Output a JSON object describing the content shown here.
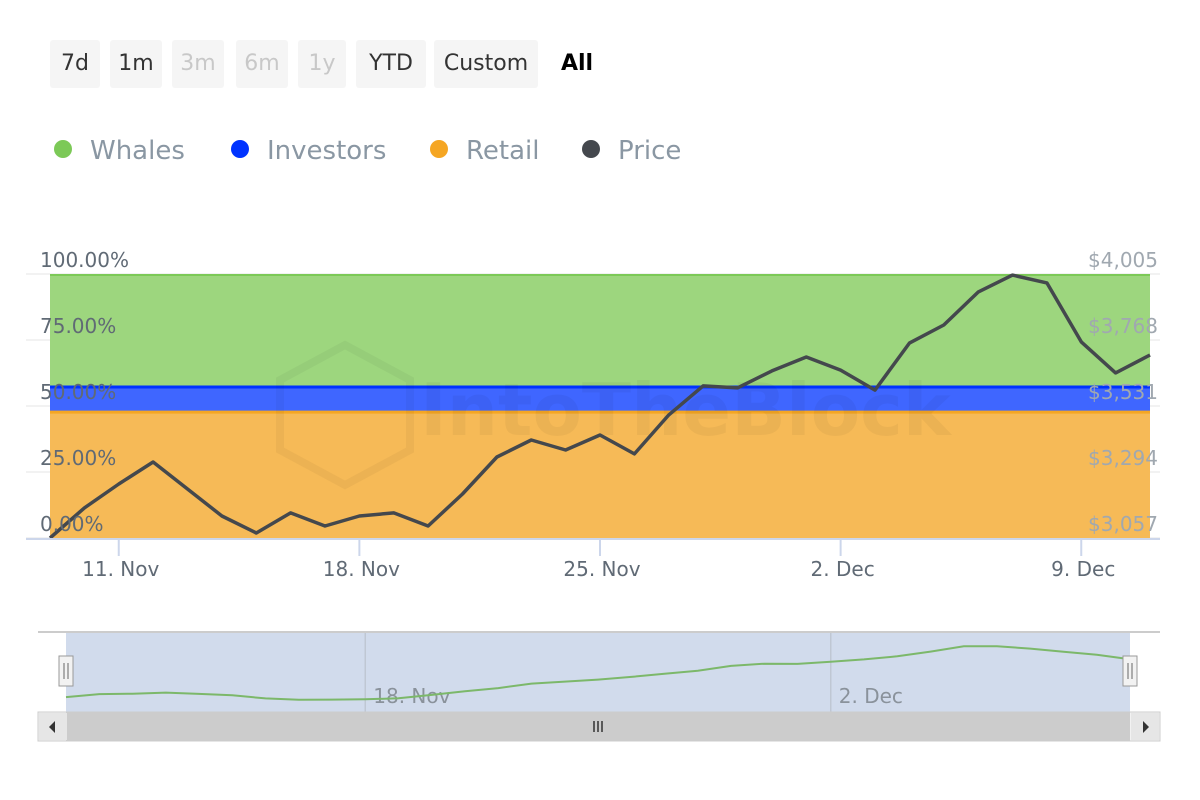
{
  "range_buttons": [
    {
      "label": "7d",
      "state": "enabled"
    },
    {
      "label": "1m",
      "state": "enabled"
    },
    {
      "label": "3m",
      "state": "disabled"
    },
    {
      "label": "6m",
      "state": "disabled"
    },
    {
      "label": "1y",
      "state": "disabled"
    },
    {
      "label": "YTD",
      "state": "enabled"
    },
    {
      "label": "Custom",
      "state": "enabled"
    },
    {
      "label": "All",
      "state": "active"
    }
  ],
  "watermark": "IntoTheBlock",
  "chart_data": {
    "type": "area",
    "stacking": "percent",
    "legend": [
      "Whales",
      "Investors",
      "Retail",
      "Price"
    ],
    "legend_placement": "top-left",
    "colors": {
      "Whales": "#7cc957",
      "Investors": "#0033ff",
      "Retail": "#f5a623",
      "Price": "#44484d"
    },
    "x_start": "2024-11-09",
    "x_end": "2024-12-11",
    "x_ticks": [
      "11. Nov",
      "18. Nov",
      "25. Nov",
      "2. Dec",
      "9. Dec"
    ],
    "y_left_ticks": [
      "0.00%",
      "25.00%",
      "50.00%",
      "75.00%",
      "100.00%"
    ],
    "y_right_ticks": [
      "$3,057",
      "$3,294",
      "$3,531",
      "$3,768",
      "$4,005"
    ],
    "y_right_range": [
      3057,
      4005
    ],
    "series": [
      {
        "name": "Retail",
        "share_pct": 47.7
      },
      {
        "name": "Investors",
        "share_pct": 9.5
      },
      {
        "name": "Whales",
        "share_pct": 42.8
      },
      {
        "name": "Price",
        "axis": "right",
        "values": [
          3057,
          3165,
          3251,
          3330,
          3233,
          3136,
          3075,
          3147,
          3100,
          3136,
          3147,
          3100,
          3215,
          3348,
          3409,
          3373,
          3427,
          3359,
          3499,
          3603,
          3596,
          3657,
          3707,
          3660,
          3588,
          3757,
          3822,
          3940,
          4001,
          3973,
          3761,
          3650,
          3714
        ]
      }
    ],
    "navigator": {
      "x_ticks": [
        "18. Nov",
        "2. Dec"
      ]
    }
  }
}
